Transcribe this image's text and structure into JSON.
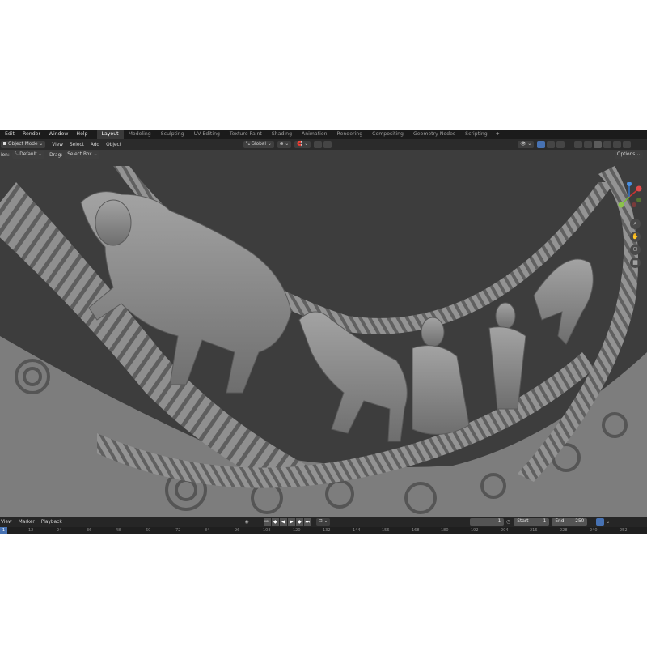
{
  "top_menu": [
    "Edit",
    "Render",
    "Window",
    "Help"
  ],
  "workspaces": [
    "Layout",
    "Modeling",
    "Sculpting",
    "UV Editing",
    "Texture Paint",
    "Shading",
    "Animation",
    "Rendering",
    "Compositing",
    "Geometry Nodes",
    "Scripting"
  ],
  "active_workspace": "Layout",
  "add_tab": "+",
  "header": {
    "mode": "Object Mode",
    "menus": [
      "View",
      "Select",
      "Add",
      "Object"
    ],
    "transform_orientation": "Global"
  },
  "tool_settings": {
    "orientation_label": "ion:",
    "orientation_value": "Default",
    "drag_label": "Drag:",
    "drag_value": "Select Box",
    "options": "Options"
  },
  "timeline": {
    "menus": [
      "View",
      "Marker",
      "Playback"
    ],
    "current_frame": "1",
    "start_label": "Start",
    "start_value": "1",
    "end_label": "End",
    "end_value": "250",
    "ruler": [
      "1",
      "12",
      "24",
      "36",
      "48",
      "60",
      "72",
      "84",
      "96",
      "108",
      "120",
      "132",
      "144",
      "156",
      "168",
      "180",
      "192",
      "204",
      "216",
      "228",
      "240",
      "252"
    ]
  },
  "colors": {
    "accent": "#4772b3",
    "mesh": "#8c8c8c",
    "background": "#3d3d3d"
  }
}
